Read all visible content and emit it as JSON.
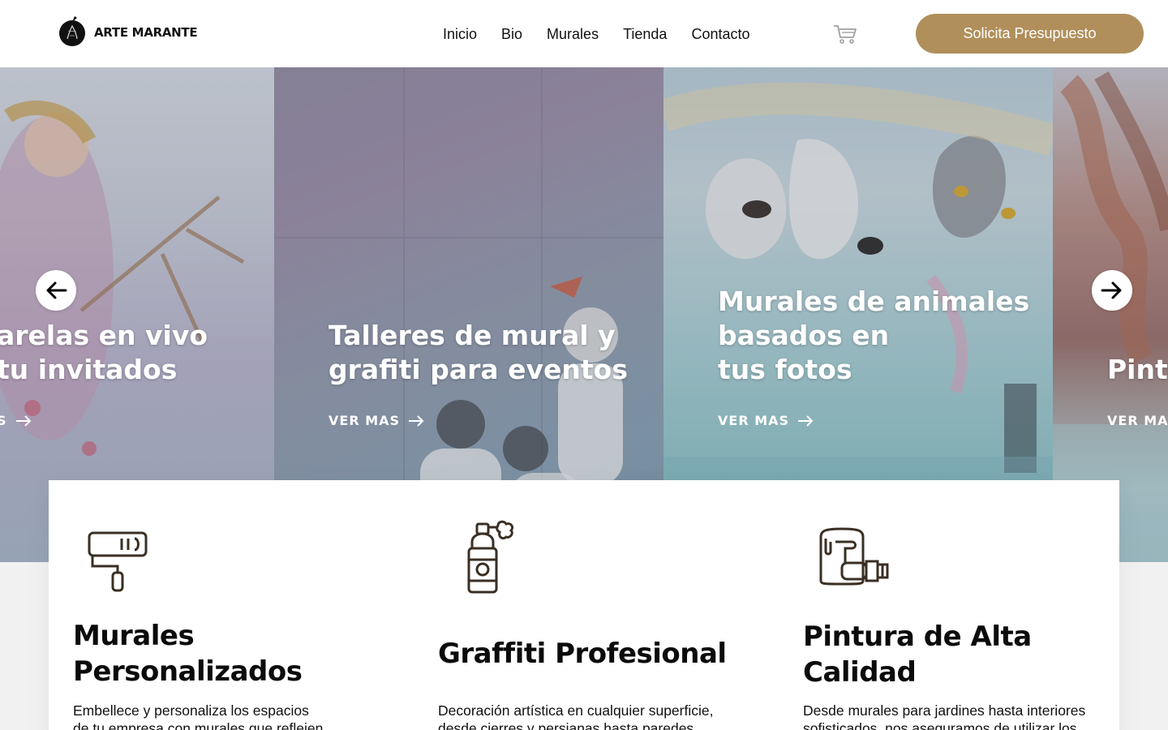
{
  "header": {
    "brand": "ARTE MARANTE",
    "nav": [
      "Inicio",
      "Bio",
      "Murales",
      "Tienda",
      "Contacto"
    ],
    "cta": "Solicita Presupuesto",
    "accent_color": "#b08f5b"
  },
  "slider": {
    "slides": [
      {
        "title": [
          "arelas en vivo",
          " tu invitados"
        ],
        "link": "S"
      },
      {
        "title": [
          "Talleres de mural y",
          "grafiti para eventos"
        ],
        "link": "VER MAS"
      },
      {
        "title": [
          "Murales de animales",
          "basados en",
          "tus fotos"
        ],
        "link": "VER MAS"
      },
      {
        "title": [
          "Pintu"
        ],
        "link": "VER MA"
      }
    ]
  },
  "features": [
    {
      "icon": "paint-roller-icon",
      "title_lines": [
        "Murales",
        "Personalizados"
      ],
      "text_lines": [
        "Embellece y personaliza los espacios",
        "de tu empresa con murales que reflejen"
      ]
    },
    {
      "icon": "spray-can-icon",
      "title_lines": [
        "Graffiti Profesional"
      ],
      "text_lines": [
        "Decoración artística en cualquier superficie,",
        "desde cierres y persianas hasta paredes"
      ]
    },
    {
      "icon": "paint-bucket-brush-icon",
      "title_lines": [
        "Pintura de Alta",
        "Calidad"
      ],
      "text_lines": [
        "Desde murales para jardines hasta interiores",
        "sofisticados, nos aseguramos de utilizar los"
      ]
    }
  ]
}
